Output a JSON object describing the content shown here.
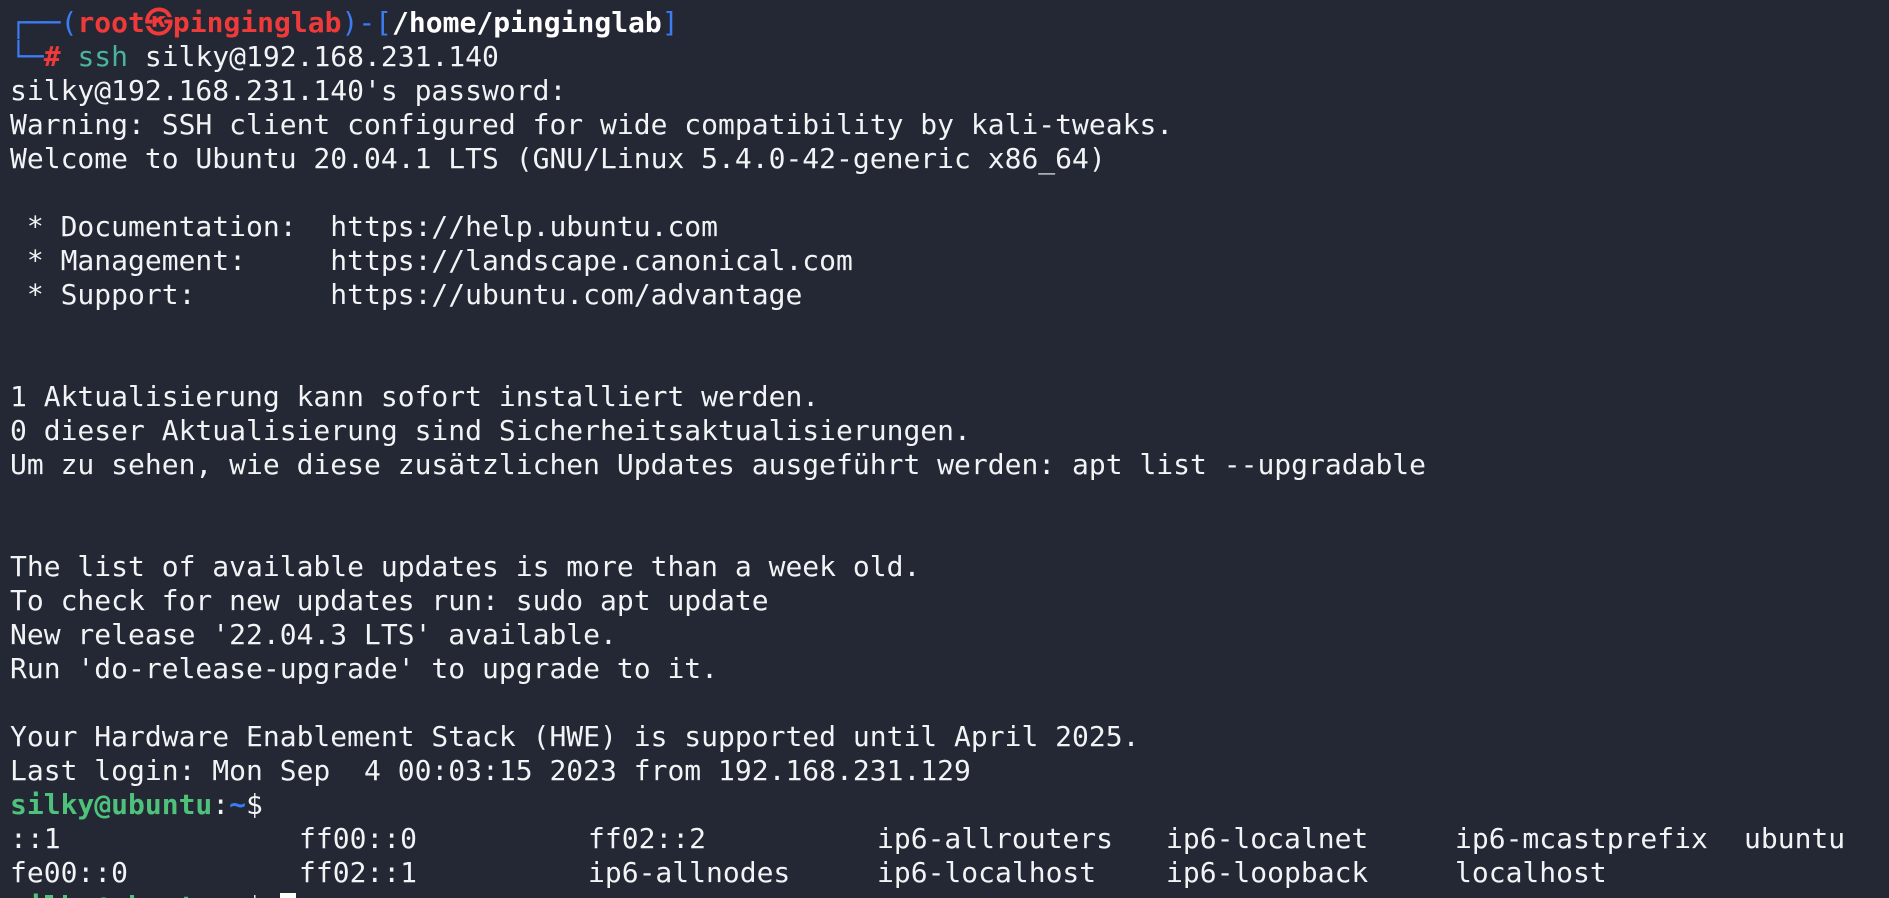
{
  "prompt_header": {
    "corner_top": "┌──(",
    "user": "root",
    "at_symbol": "㉿",
    "host": "pinginglab",
    "mid": ")-[",
    "cwd": "/home/pinginglab",
    "close": "]",
    "corner_bottom": "└─",
    "hash": "#",
    "command_name": "ssh",
    "command_args": " silky@192.168.231.140"
  },
  "lines": [
    "silky@192.168.231.140's password:",
    "Warning: SSH client configured for wide compatibility by kali-tweaks.",
    "Welcome to Ubuntu 20.04.1 LTS (GNU/Linux 5.4.0-42-generic x86_64)",
    "",
    " * Documentation:  https://help.ubuntu.com",
    " * Management:     https://landscape.canonical.com",
    " * Support:        https://ubuntu.com/advantage",
    "",
    "",
    "1 Aktualisierung kann sofort installiert werden.",
    "0 dieser Aktualisierung sind Sicherheitsaktualisierungen.",
    "Um zu sehen, wie diese zusätzlichen Updates ausgeführt werden: apt list --upgradable",
    "",
    "",
    "The list of available updates is more than a week old.",
    "To check for new updates run: sudo apt update",
    "New release '22.04.3 LTS' available.",
    "Run 'do-release-upgrade' to upgrade to it.",
    "",
    "Your Hardware Enablement Stack (HWE) is supported until April 2025.",
    "Last login: Mon Sep  4 00:03:15 2023 from 192.168.231.129"
  ],
  "remote_prompt": {
    "user_host": "silky@ubuntu",
    "colon": ":",
    "path": "~",
    "dollar": "$"
  },
  "completion": {
    "row1": [
      "::1",
      "ff00::0",
      "ff02::2",
      "ip6-allrouters",
      "ip6-localnet",
      "ip6-mcastprefix",
      "ubuntu"
    ],
    "row2": [
      "fe00::0",
      "ff02::1",
      "ip6-allnodes",
      "ip6-localhost",
      "ip6-loopback",
      "localhost"
    ]
  },
  "colors": {
    "background": "#232834",
    "foreground": "#f1f3f5",
    "prompt_blue": "#3b7cf5",
    "root_red": "#f03a3a",
    "remote_green": "#4ec27a",
    "command_teal": "#49b39b"
  }
}
